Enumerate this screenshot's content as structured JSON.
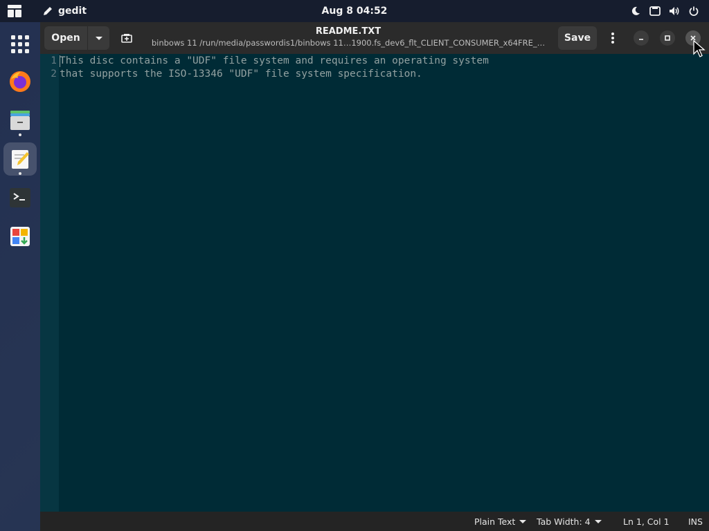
{
  "topbar": {
    "app_name": "gedit",
    "clock": "Aug 8  04:52",
    "tray": [
      "night-light-icon",
      "screen-icon",
      "volume-icon",
      "power-icon"
    ]
  },
  "dock": {
    "items": [
      "app-grid-icon",
      "firefox-icon",
      "files-icon",
      "gedit-icon",
      "terminal-icon",
      "software-icon"
    ]
  },
  "window": {
    "open_label": "Open",
    "title": "README.TXT",
    "subtitle": "binbows 11 /run/media/passwordis1/binbows 11…1900.fs_dev6_flt_CLIENT_CONSUMER_x64FRE_…",
    "save_label": "Save"
  },
  "editor": {
    "lines": [
      {
        "n": "1",
        "text": "This disc contains a \"UDF\" file system and requires an operating system"
      },
      {
        "n": "2",
        "text": "that supports the ISO-13346 \"UDF\" file system specification."
      }
    ]
  },
  "statusbar": {
    "language": "Plain Text",
    "tab_width": "Tab Width: 4",
    "position": "Ln 1, Col 1",
    "mode": "INS"
  },
  "colors": {
    "editor_bg": "#002b36",
    "gutter_bg": "#073642",
    "text": "#93a1a1",
    "line_number": "#657b83",
    "headerbar": "#2b2b2b"
  }
}
